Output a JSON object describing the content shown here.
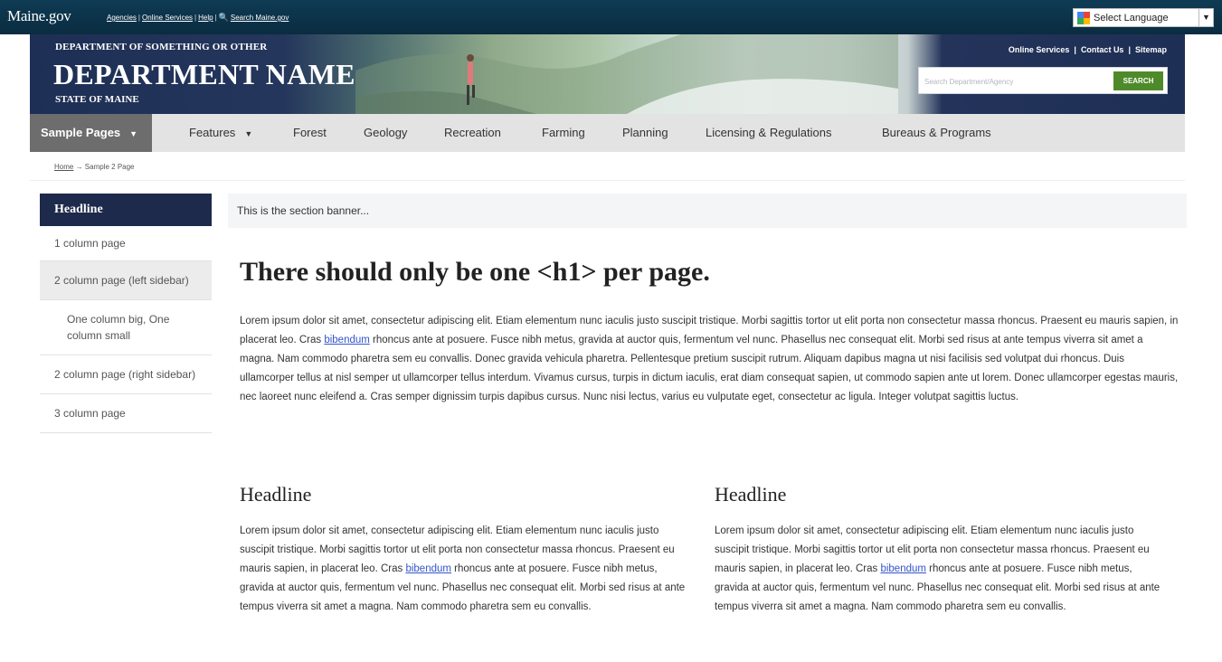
{
  "topbar": {
    "logo": "Maine.gov",
    "links": [
      "Agencies",
      "Online Services",
      "Help",
      "Search Maine.gov"
    ],
    "language": "Select Language"
  },
  "header": {
    "dept_sub": "DEPARTMENT OF SOMETHING OR OTHER",
    "dept_name": "DEPARTMENT NAME",
    "state": "STATE OF MAINE",
    "links": [
      "Online Services",
      "Contact Us",
      "Sitemap"
    ],
    "search_placeholder": "Search Department/Agency",
    "search_button": "SEARCH"
  },
  "nav": {
    "items": [
      "Sample Pages",
      "Features",
      "Forest",
      "Geology",
      "Recreation",
      "Farming",
      "Planning",
      "Licensing & Regulations",
      "Bureaus & Programs"
    ]
  },
  "breadcrumb": {
    "home": "Home",
    "current": "→ Sample 2 Page"
  },
  "sidebar": {
    "headline": "Headline",
    "items": [
      "1 column page",
      "2 column page (left sidebar)",
      "One column big, One column small",
      "2 column page (right sidebar)",
      "3 column page"
    ]
  },
  "main": {
    "banner": "This is the section banner...",
    "h1": "There should only be one <h1> per page.",
    "para_before_link": "Lorem ipsum dolor sit amet, consectetur adipiscing elit. Etiam elementum nunc iaculis justo suscipit tristique. Morbi sagittis tortor ut elit porta non consectetur massa rhoncus. Praesent eu mauris sapien, in placerat leo. Cras ",
    "link": "bibendum",
    "para_after_link": " rhoncus ante at posuere. Fusce nibh metus, gravida at auctor quis, fermentum vel nunc. Phasellus nec consequat elit. Morbi sed risus at ante tempus viverra sit amet a magna. Nam commodo pharetra sem eu convallis. Donec gravida vehicula pharetra. Pellentesque pretium suscipit rutrum. Aliquam dapibus magna ut nisi facilisis sed volutpat dui rhoncus. Duis ullamcorper tellus at nisl semper ut ullamcorper tellus interdum. Vivamus cursus, turpis in dictum iaculis, erat diam consequat sapien, ut commodo sapien ante ut lorem. Donec ullamcorper egestas mauris, nec laoreet nunc eleifend a. Cras semper dignissim turpis dapibus cursus. Nunc nisi lectus, varius eu vulputate eget, consectetur ac ligula. Integer volutpat sagittis luctus.",
    "columns": [
      {
        "headline": "Headline",
        "before_link": "Lorem ipsum dolor sit amet, consectetur adipiscing elit. Etiam elementum nunc iaculis justo suscipit tristique. Morbi sagittis tortor ut elit porta non consectetur massa rhoncus. Praesent eu mauris sapien, in placerat leo. Cras ",
        "link": "bibendum",
        "after_link": " rhoncus ante at posuere. Fusce nibh metus, gravida at auctor quis, fermentum vel nunc. Phasellus nec consequat elit. Morbi sed risus at ante tempus viverra sit amet a magna. Nam commodo pharetra sem eu convallis."
      },
      {
        "headline": "Headline",
        "before_link": "Lorem ipsum dolor sit amet, consectetur adipiscing elit. Etiam elementum nunc iaculis justo suscipit tristique. Morbi sagittis tortor ut elit porta non consectetur massa rhoncus. Praesent eu mauris sapien, in placerat leo. Cras ",
        "link": "bibendum",
        "after_link": " rhoncus ante at posuere. Fusce nibh metus, gravida at auctor quis, fermentum vel nunc. Phasellus nec consequat elit. Morbi sed risus at ante tempus viverra sit amet a magna. Nam commodo pharetra sem eu convallis."
      }
    ]
  },
  "colors": {
    "topbar": "#0e3b54",
    "header": "#1e2f55",
    "sidebar_head": "#1d2a4b",
    "nav_bg": "#e3e3e3",
    "nav_active": "#6d6d6d",
    "search_button": "#4f8a2a",
    "link": "#3355cc"
  }
}
